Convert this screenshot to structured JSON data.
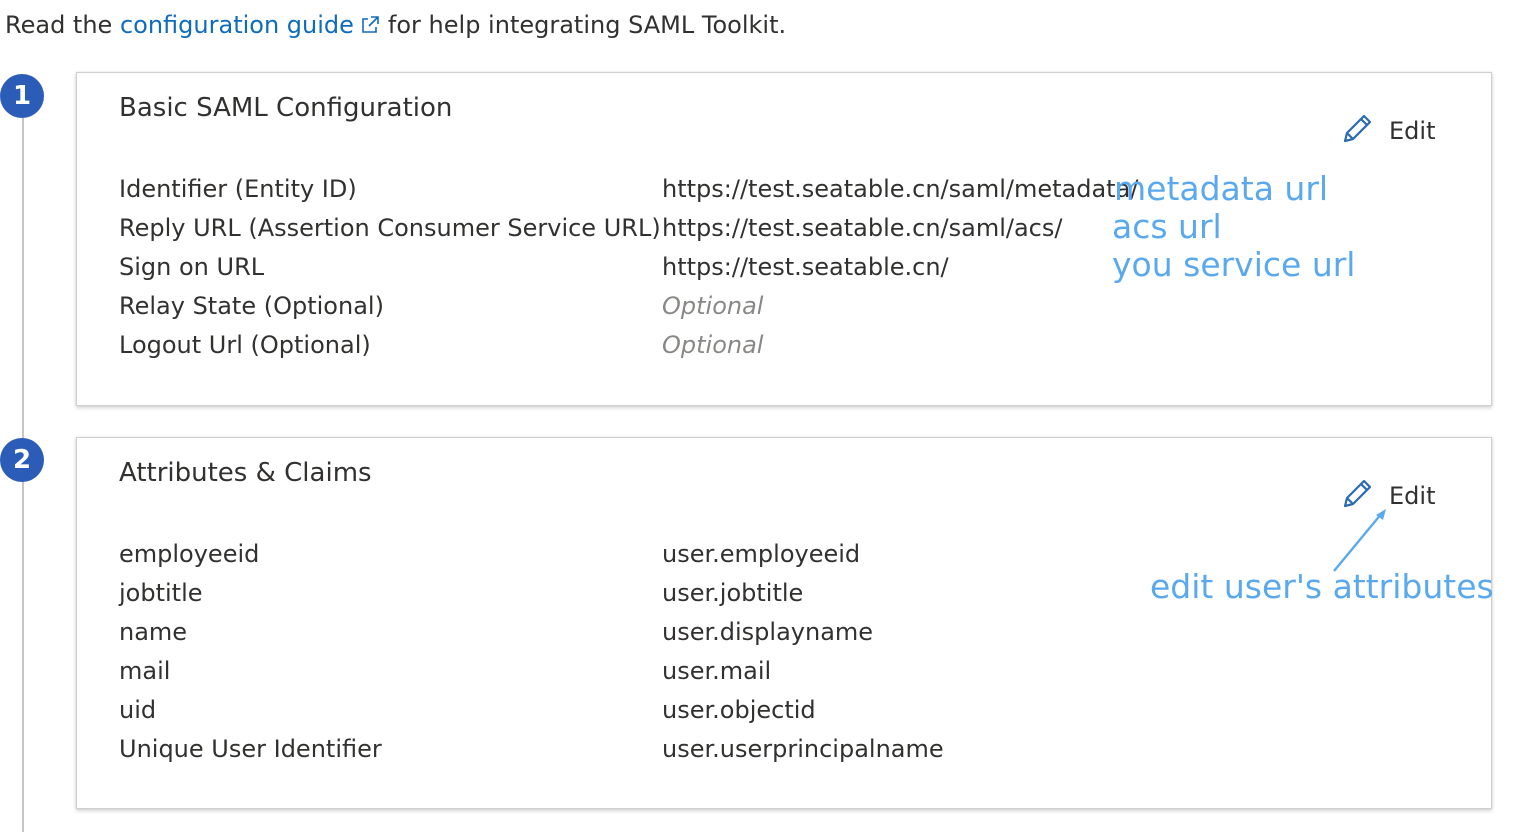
{
  "intro": {
    "prefix": "Read the",
    "link": "configuration guide",
    "suffix": "for help integrating SAML Toolkit."
  },
  "steps": [
    {
      "number": "1",
      "title": "Basic SAML Configuration",
      "edit_label": "Edit",
      "rows": [
        {
          "key": "Identifier (Entity ID)",
          "value": "https://test.seatable.cn/saml/metadata/",
          "optional": false
        },
        {
          "key": "Reply URL (Assertion Consumer Service URL)",
          "value": "https://test.seatable.cn/saml/acs/",
          "optional": false
        },
        {
          "key": "Sign on URL",
          "value": "https://test.seatable.cn/",
          "optional": false
        },
        {
          "key": "Relay State (Optional)",
          "value": "Optional",
          "optional": true
        },
        {
          "key": "Logout Url (Optional)",
          "value": "Optional",
          "optional": true
        }
      ]
    },
    {
      "number": "2",
      "title": "Attributes & Claims",
      "edit_label": "Edit",
      "rows": [
        {
          "key": "employeeid",
          "value": "user.employeeid"
        },
        {
          "key": "jobtitle",
          "value": "user.jobtitle"
        },
        {
          "key": "name",
          "value": "user.displayname"
        },
        {
          "key": "mail",
          "value": "user.mail"
        },
        {
          "key": "uid",
          "value": "user.objectid"
        },
        {
          "key": "Unique User Identifier",
          "value": "user.userprincipalname"
        }
      ]
    }
  ],
  "annotations": {
    "metadata": "metadata url",
    "acs": "acs url",
    "service": "you service url",
    "edit_attrs": "edit user's attributes"
  },
  "colors": {
    "link": "#0f6cbd",
    "step_circle": "#2b5db8",
    "annotation": "#5aa9ef",
    "pencil": "#2b6cb0"
  },
  "icons": {
    "external": "external-link-icon",
    "edit": "pencil-icon"
  }
}
